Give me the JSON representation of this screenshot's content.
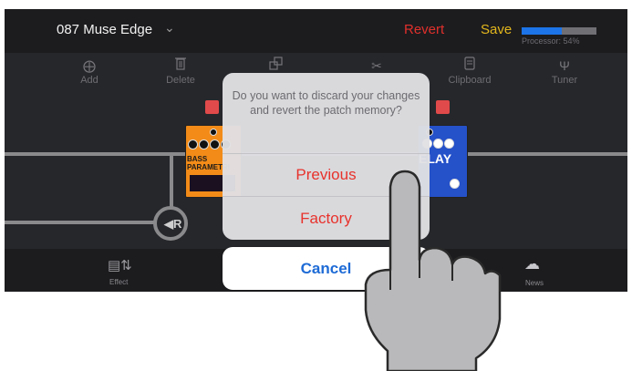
{
  "topbar": {
    "patch_name": "087 Muse Edge",
    "revert_label": "Revert",
    "save_label": "Save",
    "processor_label": "Processor: 54%",
    "processor_level": 0.54
  },
  "toolbar": {
    "items": [
      {
        "label": "Add",
        "icon": "plus-circle-icon"
      },
      {
        "label": "Delete",
        "icon": "trash-icon"
      },
      {
        "label": "",
        "icon": "move-icon"
      },
      {
        "label": "",
        "icon": "scissors-icon"
      },
      {
        "label": "Clipboard",
        "icon": "clipboard-icon"
      },
      {
        "label": "Tuner",
        "icon": "tuning-fork-icon"
      }
    ]
  },
  "board": {
    "pedal_left": {
      "label": "BASS PARAMETRI",
      "color": "#f28b18"
    },
    "pedal_right": {
      "label": "ELAY",
      "color": "#2551c9"
    },
    "return_node": "R"
  },
  "bottombar": {
    "effect_label": "Effect",
    "news_label": "News"
  },
  "dialog": {
    "message": "Do you want to discard your changes and revert the patch memory?",
    "option_previous": "Previous",
    "option_factory": "Factory",
    "cancel_label": "Cancel"
  },
  "colors": {
    "revert": "#e0302b",
    "save": "#e3b71c",
    "processor_fill": "#1c74e8",
    "destructive": "#e8322c",
    "cancel": "#1e6bd6"
  }
}
